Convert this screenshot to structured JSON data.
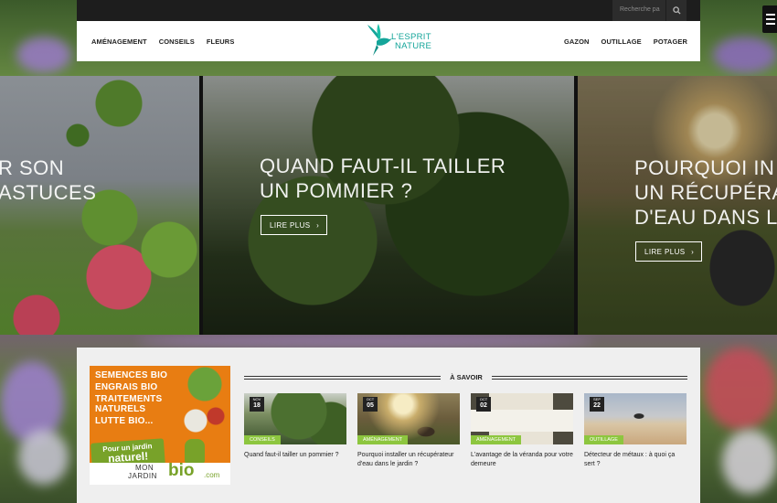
{
  "search": {
    "placeholder": "Recherche pa"
  },
  "header": {
    "nav_left": [
      "AMÉNAGEMENT",
      "CONSEILS",
      "FLEURS"
    ],
    "nav_right": [
      "GAZON",
      "OUTILLAGE",
      "POTAGER"
    ],
    "logo": {
      "line1": "L'ESPRIT",
      "line2": "NATURE"
    }
  },
  "slider": {
    "slides": [
      {
        "title_l1": "R SON",
        "title_l2": "ASTUCES"
      },
      {
        "title_l1": "QUAND FAUT-IL TAILLER",
        "title_l2": "UN POMMIER ?",
        "button": "LIRE PLUS"
      },
      {
        "title_l1": "POURQUOI IN",
        "title_l2": "UN RÉCUPÉRA",
        "title_l3": "D'EAU DANS L",
        "button": "LIRE PLUS"
      }
    ]
  },
  "ad": {
    "lines": [
      "SEMENCES BIO",
      "ENGRAIS BIO",
      "TRAITEMENTS",
      "NATURELS",
      "LUTTE BIO..."
    ],
    "bubble_l1": "Pour un jardin",
    "bubble_l2": "naturel!",
    "brand_mon": "MON",
    "brand_jardin": "JARDIN",
    "brand_bio": "bio",
    "brand_com": ".com"
  },
  "savoir": {
    "heading": "À SAVOIR",
    "cards": [
      {
        "month": "NOV",
        "day": "18",
        "category": "CONSEILS",
        "title": "Quand faut-il tailler un pommier ?"
      },
      {
        "month": "OCT",
        "day": "05",
        "category": "AMÉNAGEMENT",
        "title": "Pourquoi installer un récupérateur d'eau dans le jardin ?"
      },
      {
        "month": "OCT",
        "day": "02",
        "category": "AMÉNAGEMENT",
        "title": "L'avantage de la véranda pour votre demeure"
      },
      {
        "month": "SEP",
        "day": "22",
        "category": "OUTILLAGE",
        "title": "Détecteur de métaux : à quoi ça sert ?"
      }
    ]
  },
  "colors": {
    "accent": "#8dc63f",
    "logo": "#15a59a",
    "ad_orange": "#e87d12",
    "ad_green": "#78a229"
  }
}
